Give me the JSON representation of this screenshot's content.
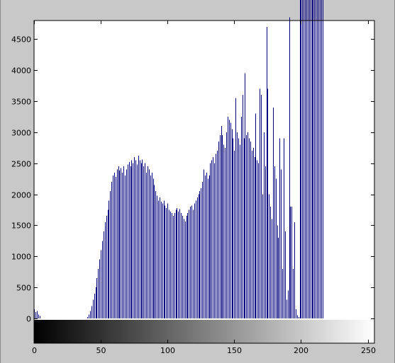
{
  "chart_data": {
    "type": "bar",
    "title": "",
    "xlabel": "",
    "ylabel": "",
    "xlim": [
      0,
      255
    ],
    "ylim": [
      0,
      4800
    ],
    "display_ylim_min": -400,
    "xticks": [
      0,
      50,
      100,
      150,
      200,
      250
    ],
    "yticks": [
      0,
      500,
      1000,
      1500,
      2000,
      2500,
      3000,
      3500,
      4000,
      4500
    ],
    "grid": false,
    "legend": "none",
    "bar_color": "#000080",
    "plot_background": "#ffffff",
    "figure_background": "#c8c8c8",
    "colorbar": "grayscale 0-255 below axis",
    "x": [
      0,
      1,
      2,
      3,
      4,
      40,
      41,
      42,
      43,
      44,
      45,
      46,
      47,
      48,
      49,
      50,
      51,
      52,
      53,
      54,
      55,
      56,
      57,
      58,
      59,
      60,
      61,
      62,
      63,
      64,
      65,
      66,
      67,
      68,
      69,
      70,
      71,
      72,
      73,
      74,
      75,
      76,
      77,
      78,
      79,
      80,
      81,
      82,
      83,
      84,
      85,
      86,
      87,
      88,
      89,
      90,
      91,
      92,
      93,
      94,
      95,
      96,
      97,
      98,
      99,
      100,
      101,
      102,
      103,
      104,
      105,
      106,
      107,
      108,
      109,
      110,
      111,
      112,
      113,
      114,
      115,
      116,
      117,
      118,
      119,
      120,
      121,
      122,
      123,
      124,
      125,
      126,
      127,
      128,
      129,
      130,
      131,
      132,
      133,
      134,
      135,
      136,
      137,
      138,
      139,
      140,
      141,
      142,
      143,
      144,
      145,
      146,
      147,
      148,
      149,
      150,
      151,
      152,
      153,
      154,
      155,
      156,
      157,
      158,
      159,
      160,
      161,
      162,
      163,
      164,
      165,
      166,
      167,
      168,
      169,
      170,
      171,
      172,
      173,
      174,
      175,
      176,
      177,
      178,
      179,
      180,
      181,
      182,
      183,
      184,
      185,
      186,
      187,
      188,
      189,
      190,
      191,
      192,
      193,
      194,
      195,
      196,
      197,
      198,
      199,
      200,
      201,
      202,
      203,
      204,
      205,
      206,
      207,
      208,
      209,
      210,
      211,
      212,
      213,
      214,
      215,
      216
    ],
    "values": [
      150,
      100,
      120,
      60,
      40,
      20,
      60,
      120,
      200,
      300,
      400,
      500,
      650,
      800,
      950,
      1100,
      1250,
      1400,
      1550,
      1650,
      1750,
      1900,
      2050,
      2200,
      2300,
      2350,
      2280,
      2400,
      2450,
      2380,
      2420,
      2350,
      2450,
      2300,
      2400,
      2480,
      2520,
      2450,
      2550,
      2500,
      2600,
      2550,
      2480,
      2620,
      2550,
      2500,
      2560,
      2450,
      2500,
      2350,
      2450,
      2400,
      2300,
      2350,
      2250,
      2150,
      2050,
      1980,
      1900,
      1950,
      1880,
      1850,
      1900,
      1820,
      1780,
      1850,
      1750,
      1720,
      1700,
      1650,
      1700,
      1750,
      1780,
      1720,
      1760,
      1700,
      1650,
      1600,
      1560,
      1650,
      1700,
      1750,
      1800,
      1820,
      1750,
      1850,
      1900,
      1950,
      2000,
      2050,
      2100,
      2200,
      2400,
      2300,
      2350,
      2250,
      2300,
      2500,
      2550,
      2600,
      2500,
      2650,
      2700,
      2850,
      2950,
      3100,
      2950,
      2800,
      2750,
      3000,
      3250,
      3200,
      3150,
      3050,
      2900,
      2700,
      3550,
      3000,
      2900,
      2800,
      3250,
      3600,
      2900,
      3950,
      2950,
      3000,
      2900,
      2850,
      2700,
      2750,
      2600,
      3300,
      2550,
      2500,
      3700,
      3600,
      2000,
      3000,
      2450,
      4700,
      3700,
      2000,
      1800,
      1600,
      3400,
      2450,
      2250,
      1500,
      1300,
      2900,
      2400,
      800,
      2900,
      1400,
      300,
      450,
      4850,
      1800,
      1800,
      800,
      1550,
      150,
      50,
      20
    ]
  }
}
